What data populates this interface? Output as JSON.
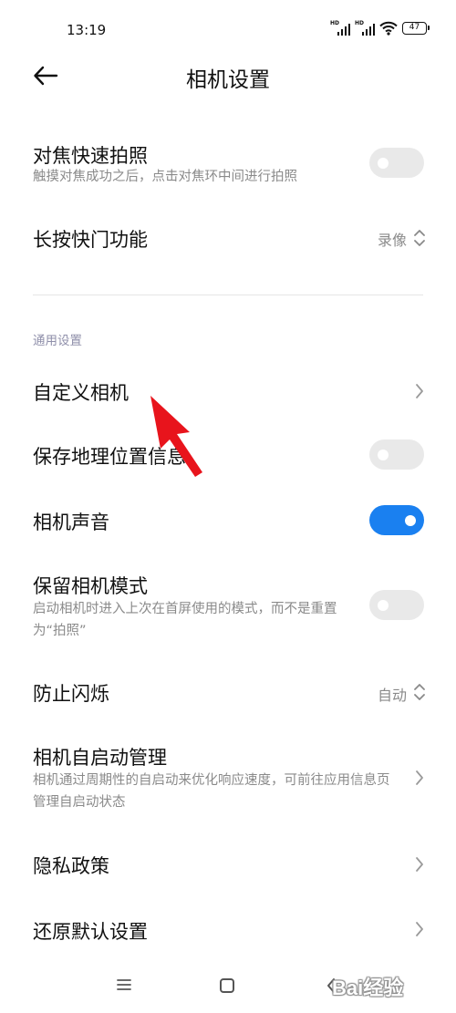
{
  "status_bar": {
    "time": "13:19",
    "signal1_label": "HD",
    "signal2_label": "HD",
    "battery": "47"
  },
  "header": {
    "title": "相机设置"
  },
  "settings": {
    "focus_shoot": {
      "title": "对焦快速拍照",
      "subtitle": "触摸对焦成功之后，点击对焦环中间进行拍照",
      "enabled": false
    },
    "long_press_shutter": {
      "title": "长按快门功能",
      "value": "录像"
    },
    "section_general": "通用设置",
    "custom_camera": {
      "title": "自定义相机"
    },
    "save_location": {
      "title": "保存地理位置信息",
      "enabled": false
    },
    "camera_sound": {
      "title": "相机声音",
      "enabled": true
    },
    "keep_mode": {
      "title": "保留相机模式",
      "subtitle": "启动相机时进入上次在首屏使用的模式，而不是重置为“拍照”",
      "enabled": false
    },
    "anti_flicker": {
      "title": "防止闪烁",
      "value": "自动"
    },
    "autostart": {
      "title": "相机自启动管理",
      "subtitle": "相机通过周期性的自启动来优化响应速度，可前往应用信息页管理自启动状态"
    },
    "privacy_policy": {
      "title": "隐私政策"
    },
    "reset_defaults": {
      "title": "还原默认设置"
    }
  },
  "watermark": "Bai经验",
  "colors": {
    "accent": "#1a80f0",
    "annotation_arrow": "#e8141c",
    "toggle_off": "#e9e9e9",
    "secondary_text": "#8a8a8a"
  }
}
